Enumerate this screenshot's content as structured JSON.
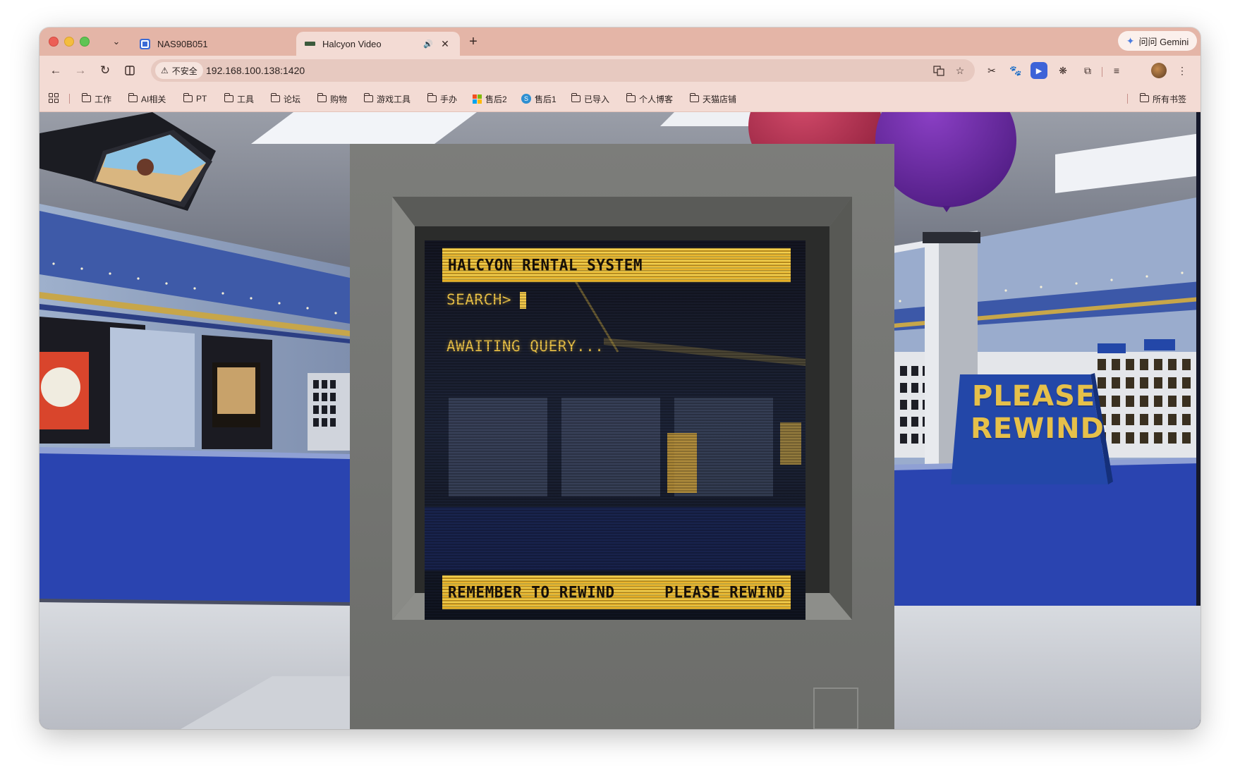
{
  "browser": {
    "tabs": [
      {
        "title": "NAS90B051",
        "active": false
      },
      {
        "title": "Halcyon Video",
        "active": true
      }
    ],
    "gemini_label": "问问 Gemini",
    "security_label": "不安全",
    "url": "192.168.100.138:1420",
    "colors": {
      "tabstrip": "#e4b5a7",
      "toolbar": "#f3dbd4",
      "omnibox": "#e7c9c0"
    }
  },
  "bookmarks": {
    "items": [
      "工作",
      "AI相关",
      "PT",
      "工具",
      "论坛",
      "购物",
      "游戏工具",
      "手办",
      "售后2",
      "售后1",
      "已导入",
      "个人博客",
      "天猫店铺"
    ],
    "all_bookmarks": "所有书签"
  },
  "terminal": {
    "header": "HALCYON RENTAL SYSTEM",
    "prompt": "SEARCH>",
    "status": "AWAITING QUERY...",
    "footer_left": "REMEMBER TO REWIND",
    "footer_right": "PLEASE REWIND",
    "text_color": "#f3c94a",
    "bar_color": "#f0c33a"
  },
  "scene": {
    "sign_line1": "PLEASE",
    "sign_line2": "REWIND",
    "sign_color": "#2347a8"
  }
}
